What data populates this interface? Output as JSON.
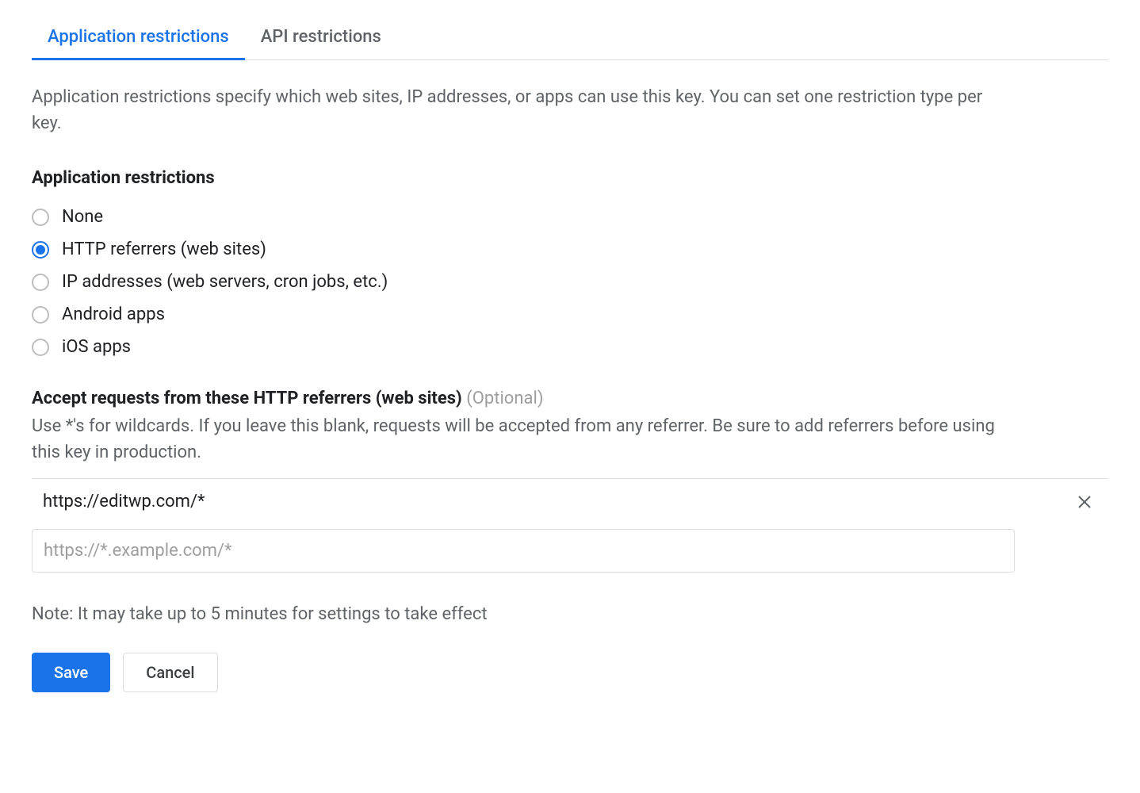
{
  "tabs": {
    "application": "Application restrictions",
    "api": "API restrictions"
  },
  "description": "Application restrictions specify which web sites, IP addresses, or apps can use this key. You can set one restriction type per key.",
  "restrictions": {
    "heading": "Application restrictions",
    "options": {
      "none": "None",
      "http": "HTTP referrers (web sites)",
      "ip": "IP addresses (web servers, cron jobs, etc.)",
      "android": "Android apps",
      "ios": "iOS apps"
    },
    "selected": "http"
  },
  "referrers": {
    "heading": "Accept requests from these HTTP referrers (web sites)",
    "optional": "(Optional)",
    "help": "Use *'s for wildcards. If you leave this blank, requests will be accepted from any referrer. Be sure to add referrers before using this key in production.",
    "entries": [
      "https://editwp.com/*"
    ],
    "placeholder": "https://*.example.com/*"
  },
  "note": "Note: It may take up to 5 minutes for settings to take effect",
  "buttons": {
    "save": "Save",
    "cancel": "Cancel"
  }
}
